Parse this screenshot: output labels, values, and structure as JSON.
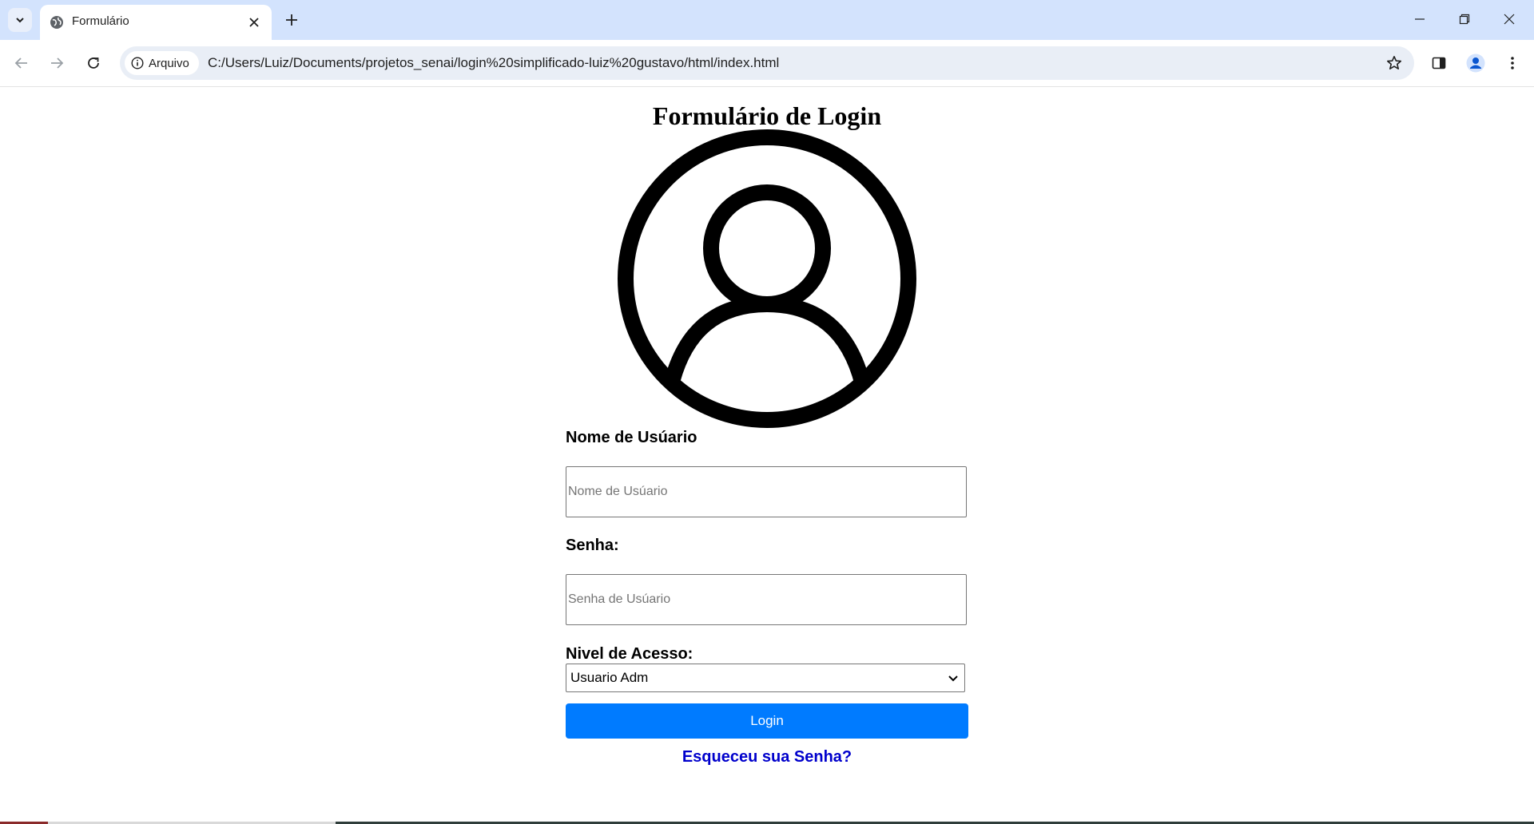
{
  "browser": {
    "tab": {
      "title": "Formulário"
    },
    "address_bar": {
      "site_info_label": "Arquivo",
      "url": "C:/Users/Luiz/Documents/projetos_senai/login%20simplificado-luiz%20gustavo/html/index.html"
    },
    "icons": {
      "tab_search": "chevron-down-icon",
      "favicon": "globe-icon",
      "close_tab": "close-icon",
      "new_tab": "plus-icon",
      "back": "arrow-left-icon",
      "forward": "arrow-right-icon",
      "reload": "reload-icon",
      "info": "info-icon",
      "bookmark": "star-icon",
      "side_panel": "side-panel-icon",
      "profile": "profile-icon",
      "menu": "kebab-menu-icon",
      "minimize": "minimize-icon",
      "restore": "restore-icon",
      "close_window": "close-icon"
    }
  },
  "page": {
    "title": "Formulário de Login",
    "avatar_icon": "user-circle-icon",
    "username": {
      "label": "Nome de Usúario",
      "placeholder": "Nome de Usúario",
      "value": ""
    },
    "password": {
      "label": "Senha:",
      "placeholder": "Senha de Usúario",
      "value": ""
    },
    "access_level": {
      "label": "Nivel de Acesso:",
      "selected": "Usuario Adm"
    },
    "login_button": "Login",
    "forgot_link": "Esqueceu sua Senha?",
    "colors": {
      "button_bg": "#007bff",
      "link": "#0000cc",
      "tabstrip": "#d3e3fd"
    }
  }
}
